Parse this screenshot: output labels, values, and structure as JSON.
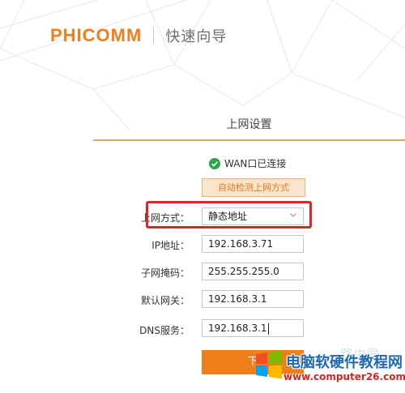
{
  "header": {
    "logo_text": "PHICOMM",
    "subtitle": "快速向导"
  },
  "panel": {
    "title": "上网设置",
    "wan_status": "WAN口已连接",
    "detect_button": "自动检测上网方式"
  },
  "form": {
    "mode_label": "上网方式：",
    "mode_value": "静态地址",
    "ip_label": "IP地址：",
    "ip_value": "192.168.3.71",
    "mask_label": "子网掩码：",
    "mask_value": "255.255.255.0",
    "gateway_label": "默认网关：",
    "gateway_value": "192.168.3.1",
    "dns_label": "DNS服务：",
    "dns_value": "192.168.3.1"
  },
  "next_button": "下",
  "watermark": {
    "title": "电脑软硬件教程网",
    "url": "www.computer26.com",
    "faint_text": "路由器"
  },
  "colors": {
    "brand_orange": "#f07f1b",
    "accent_rule": "#e3a46a",
    "highlight_red": "#d42a2a",
    "success_green": "#2aa84a"
  }
}
